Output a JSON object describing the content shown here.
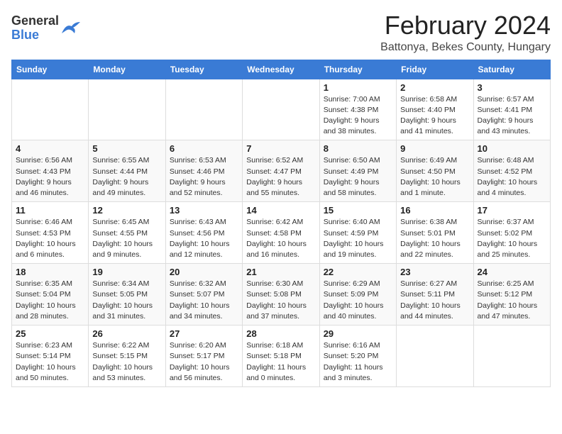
{
  "logo": {
    "general": "General",
    "blue": "Blue"
  },
  "title": "February 2024",
  "location": "Battonya, Bekes County, Hungary",
  "days_header": [
    "Sunday",
    "Monday",
    "Tuesday",
    "Wednesday",
    "Thursday",
    "Friday",
    "Saturday"
  ],
  "weeks": [
    [
      {
        "day": "",
        "info": ""
      },
      {
        "day": "",
        "info": ""
      },
      {
        "day": "",
        "info": ""
      },
      {
        "day": "",
        "info": ""
      },
      {
        "day": "1",
        "info": "Sunrise: 7:00 AM\nSunset: 4:38 PM\nDaylight: 9 hours\nand 38 minutes."
      },
      {
        "day": "2",
        "info": "Sunrise: 6:58 AM\nSunset: 4:40 PM\nDaylight: 9 hours\nand 41 minutes."
      },
      {
        "day": "3",
        "info": "Sunrise: 6:57 AM\nSunset: 4:41 PM\nDaylight: 9 hours\nand 43 minutes."
      }
    ],
    [
      {
        "day": "4",
        "info": "Sunrise: 6:56 AM\nSunset: 4:43 PM\nDaylight: 9 hours\nand 46 minutes."
      },
      {
        "day": "5",
        "info": "Sunrise: 6:55 AM\nSunset: 4:44 PM\nDaylight: 9 hours\nand 49 minutes."
      },
      {
        "day": "6",
        "info": "Sunrise: 6:53 AM\nSunset: 4:46 PM\nDaylight: 9 hours\nand 52 minutes."
      },
      {
        "day": "7",
        "info": "Sunrise: 6:52 AM\nSunset: 4:47 PM\nDaylight: 9 hours\nand 55 minutes."
      },
      {
        "day": "8",
        "info": "Sunrise: 6:50 AM\nSunset: 4:49 PM\nDaylight: 9 hours\nand 58 minutes."
      },
      {
        "day": "9",
        "info": "Sunrise: 6:49 AM\nSunset: 4:50 PM\nDaylight: 10 hours\nand 1 minute."
      },
      {
        "day": "10",
        "info": "Sunrise: 6:48 AM\nSunset: 4:52 PM\nDaylight: 10 hours\nand 4 minutes."
      }
    ],
    [
      {
        "day": "11",
        "info": "Sunrise: 6:46 AM\nSunset: 4:53 PM\nDaylight: 10 hours\nand 6 minutes."
      },
      {
        "day": "12",
        "info": "Sunrise: 6:45 AM\nSunset: 4:55 PM\nDaylight: 10 hours\nand 9 minutes."
      },
      {
        "day": "13",
        "info": "Sunrise: 6:43 AM\nSunset: 4:56 PM\nDaylight: 10 hours\nand 12 minutes."
      },
      {
        "day": "14",
        "info": "Sunrise: 6:42 AM\nSunset: 4:58 PM\nDaylight: 10 hours\nand 16 minutes."
      },
      {
        "day": "15",
        "info": "Sunrise: 6:40 AM\nSunset: 4:59 PM\nDaylight: 10 hours\nand 19 minutes."
      },
      {
        "day": "16",
        "info": "Sunrise: 6:38 AM\nSunset: 5:01 PM\nDaylight: 10 hours\nand 22 minutes."
      },
      {
        "day": "17",
        "info": "Sunrise: 6:37 AM\nSunset: 5:02 PM\nDaylight: 10 hours\nand 25 minutes."
      }
    ],
    [
      {
        "day": "18",
        "info": "Sunrise: 6:35 AM\nSunset: 5:04 PM\nDaylight: 10 hours\nand 28 minutes."
      },
      {
        "day": "19",
        "info": "Sunrise: 6:34 AM\nSunset: 5:05 PM\nDaylight: 10 hours\nand 31 minutes."
      },
      {
        "day": "20",
        "info": "Sunrise: 6:32 AM\nSunset: 5:07 PM\nDaylight: 10 hours\nand 34 minutes."
      },
      {
        "day": "21",
        "info": "Sunrise: 6:30 AM\nSunset: 5:08 PM\nDaylight: 10 hours\nand 37 minutes."
      },
      {
        "day": "22",
        "info": "Sunrise: 6:29 AM\nSunset: 5:09 PM\nDaylight: 10 hours\nand 40 minutes."
      },
      {
        "day": "23",
        "info": "Sunrise: 6:27 AM\nSunset: 5:11 PM\nDaylight: 10 hours\nand 44 minutes."
      },
      {
        "day": "24",
        "info": "Sunrise: 6:25 AM\nSunset: 5:12 PM\nDaylight: 10 hours\nand 47 minutes."
      }
    ],
    [
      {
        "day": "25",
        "info": "Sunrise: 6:23 AM\nSunset: 5:14 PM\nDaylight: 10 hours\nand 50 minutes."
      },
      {
        "day": "26",
        "info": "Sunrise: 6:22 AM\nSunset: 5:15 PM\nDaylight: 10 hours\nand 53 minutes."
      },
      {
        "day": "27",
        "info": "Sunrise: 6:20 AM\nSunset: 5:17 PM\nDaylight: 10 hours\nand 56 minutes."
      },
      {
        "day": "28",
        "info": "Sunrise: 6:18 AM\nSunset: 5:18 PM\nDaylight: 11 hours\nand 0 minutes."
      },
      {
        "day": "29",
        "info": "Sunrise: 6:16 AM\nSunset: 5:20 PM\nDaylight: 11 hours\nand 3 minutes."
      },
      {
        "day": "",
        "info": ""
      },
      {
        "day": "",
        "info": ""
      }
    ]
  ]
}
